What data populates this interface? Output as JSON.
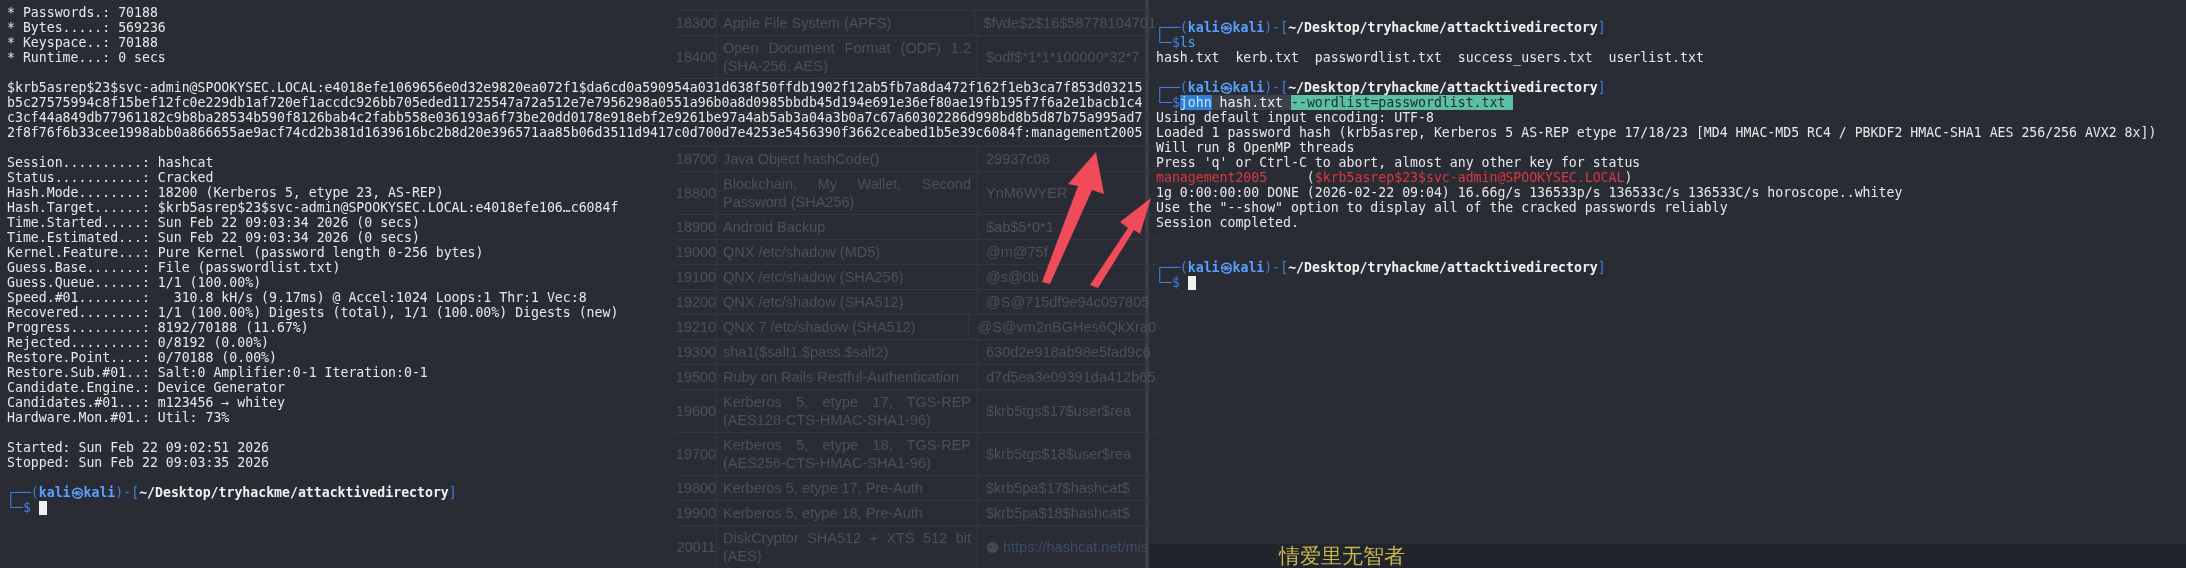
{
  "left_pane": {
    "lines": [
      {
        "kind": "text",
        "text": "* Passwords.: 70188"
      },
      {
        "kind": "text",
        "text": "* Bytes.....: 569236"
      },
      {
        "kind": "text",
        "text": "* Keyspace..: 70188"
      },
      {
        "kind": "text",
        "text": "* Runtime...: 0 secs"
      },
      {
        "kind": "blank"
      },
      {
        "kind": "wrapped",
        "text": "$krb5asrep$23$svc-admin@SPOOKYSEC.LOCAL:e4018efe1069656e0d32e9820ea072f1$da6cd0a590954a031d638f50ffdb1902f12ab5fb7a8da472f162f1eb3ca7f853d03215b5c27575994c8f15bef12fc0e229db1af720ef1accdc926bb705eded11725547a72a512e7e7956298a0551a96b0a8d0985bbdb45d194e691e36ef80ae19fb195f7f6a2e1bacb1c4c3cf44a849db77961182c9b8ba28534b590f8126bab4c2fabb558e036193a6f73be20dd0178e918ebf2e9261be97a4ab5ab3a04a3b0a7c67a60302286d998bd8b5d87b75a995ad72f8f76f6b33cee1998abb0a866655ae9acf74cd2b381d1639616bc2b8d20e396571aa85b06d3511d9417c0d700d7e4253e5456390f3662ceabed1b5e39c6084f:management2005"
      },
      {
        "kind": "blank"
      },
      {
        "kind": "text",
        "text": "Session..........: hashcat"
      },
      {
        "kind": "text",
        "text": "Status...........: Cracked"
      },
      {
        "kind": "text",
        "text": "Hash.Mode........: 18200 (Kerberos 5, etype 23, AS-REP)"
      },
      {
        "kind": "text",
        "text": "Hash.Target......: $krb5asrep$23$svc-admin@SPOOKYSEC.LOCAL:e4018efe106…c6084f"
      },
      {
        "kind": "text",
        "text": "Time.Started.....: Sun Feb 22 09:03:34 2026 (0 secs)"
      },
      {
        "kind": "text",
        "text": "Time.Estimated...: Sun Feb 22 09:03:34 2026 (0 secs)"
      },
      {
        "kind": "text",
        "text": "Kernel.Feature...: Pure Kernel (password length 0-256 bytes)"
      },
      {
        "kind": "text",
        "text": "Guess.Base.......: File (passwordlist.txt)"
      },
      {
        "kind": "text",
        "text": "Guess.Queue......: 1/1 (100.00%)"
      },
      {
        "kind": "text",
        "text": "Speed.#01........:   310.8 kH/s (9.17ms) @ Accel:1024 Loops:1 Thr:1 Vec:8"
      },
      {
        "kind": "text",
        "text": "Recovered........: 1/1 (100.00%) Digests (total), 1/1 (100.00%) Digests (new)"
      },
      {
        "kind": "text",
        "text": "Progress.........: 8192/70188 (11.67%)"
      },
      {
        "kind": "text",
        "text": "Rejected.........: 0/8192 (0.00%)"
      },
      {
        "kind": "text",
        "text": "Restore.Point....: 0/70188 (0.00%)"
      },
      {
        "kind": "text",
        "text": "Restore.Sub.#01..: Salt:0 Amplifier:0-1 Iteration:0-1"
      },
      {
        "kind": "text",
        "text": "Candidate.Engine.: Device Generator"
      },
      {
        "kind": "text",
        "text": "Candidates.#01...: m123456 → whitey"
      },
      {
        "kind": "text",
        "text": "Hardware.Mon.#01.: Util: 73%"
      },
      {
        "kind": "blank"
      },
      {
        "kind": "text",
        "text": "Started: Sun Feb 22 09:02:51 2026"
      },
      {
        "kind": "text",
        "text": "Stopped: Sun Feb 22 09:03:35 2026"
      },
      {
        "kind": "blank"
      },
      {
        "kind": "prompt",
        "head": [
          "┌──(",
          "kali㉿kali",
          ")-[",
          "~/Desktop/tryhackme/attacktivedirectory",
          "]"
        ],
        "tail": "└─$",
        "cursor": true
      }
    ]
  },
  "background_table": {
    "rows": [
      {
        "kind": "row",
        "mode": "18300",
        "name": "Apple File System (APFS)",
        "example": "$fvde$2$16$58778104701"
      },
      {
        "kind": "row",
        "mode": "18400",
        "name": "Open Document Format (ODF) 1.2 (SHA-256, AES)",
        "example": "$odf$*1*1*100000*32*7"
      },
      {
        "kind": "covered"
      },
      {
        "kind": "covered"
      },
      {
        "kind": "row",
        "mode": "18700",
        "name": "Java Object hashCode()",
        "example": "29937c08"
      },
      {
        "kind": "row",
        "mode": "18800",
        "name": "Blockchain, My Wallet, Second Password (SHA256)",
        "example": "YnM6WYER"
      },
      {
        "kind": "row",
        "mode": "18900",
        "name": "Android Backup",
        "example": "$ab$5*0*1"
      },
      {
        "kind": "row",
        "mode": "19000",
        "name": "QNX /etc/shadow (MD5)",
        "example": "@m@75f"
      },
      {
        "kind": "row",
        "mode": "19100",
        "name": "QNX /etc/shadow (SHA256)",
        "example": "@s@0b"
      },
      {
        "kind": "row",
        "mode": "19200",
        "name": "QNX /etc/shadow (SHA512)",
        "example": "@S@715df9e94c097805"
      },
      {
        "kind": "row",
        "mode": "19210",
        "name": "QNX 7 /etc/shadow (SHA512)",
        "example": "@S@vm2nBGHes6QkXra0"
      },
      {
        "kind": "row",
        "mode": "19300",
        "name": "sha1($salt1.$pass.$salt2)",
        "example": "630d2e918ab98e5fad9c6"
      },
      {
        "kind": "row",
        "mode": "19500",
        "name": "Ruby on Rails Restful-Authentication",
        "example": "d7d5ea3e09391da412b65"
      },
      {
        "kind": "row",
        "mode": "19600",
        "name": "Kerberos 5, etype 17, TGS-REP (AES128-CTS-HMAC-SHA1-96)",
        "example": "$krb5tgs$17$user$rea"
      },
      {
        "kind": "row",
        "mode": "19700",
        "name": "Kerberos 5, etype 18, TGS-REP (AES256-CTS-HMAC-SHA1-96)",
        "example": "$krb5tgs$18$user$rea"
      },
      {
        "kind": "row",
        "mode": "19800",
        "name": "Kerberos 5, etype 17, Pre-Auth",
        "example": "$krb5pa$17$hashcat$"
      },
      {
        "kind": "row",
        "mode": "19900",
        "name": "Kerberos 5, etype 18, Pre-Auth",
        "example": "$krb5pa$18$hashcat$"
      },
      {
        "kind": "link_row",
        "mode": "20011",
        "name": "DiskCryptor SHA512 + XTS 512 bit (AES)",
        "example": "https://hashcat.net/mis"
      }
    ]
  },
  "right_pane": {
    "lines": [
      {
        "kind": "blank"
      },
      {
        "kind": "prompt",
        "head": [
          "┌──(",
          "kali㉿kali",
          ")-[",
          "~/Desktop/tryhackme/attacktivedirectory",
          "]"
        ],
        "tail": "└─$",
        "command": [
          {
            "text": "ls",
            "kind": "program"
          }
        ],
        "cursor": false
      },
      {
        "kind": "text",
        "text": "hash.txt  kerb.txt  passwordlist.txt  success_users.txt  userlist.txt"
      },
      {
        "kind": "blank"
      },
      {
        "kind": "prompt",
        "head": [
          "┌──(",
          "kali㉿kali",
          ")-[",
          "~/Desktop/tryhackme/attacktivedirectory",
          "]"
        ],
        "tail": "└─$",
        "command": [
          {
            "text": "john",
            "kind": "selection"
          },
          {
            "text": " hash.txt ",
            "kind": "argument"
          },
          {
            "text": "--wordlist=passwordlist.txt ",
            "kind": "option"
          }
        ],
        "cursor": false
      },
      {
        "kind": "text",
        "text": "Using default input encoding: UTF-8"
      },
      {
        "kind": "text",
        "text": "Loaded 1 password hash (krb5asrep, Kerberos 5 AS-REP etype 17/18/23 [MD4 HMAC-MD5 RC4 / PBKDF2 HMAC-SHA1 AES 256/256 AVX2 8x])"
      },
      {
        "kind": "text",
        "text": "Will run 8 OpenMP threads"
      },
      {
        "kind": "text",
        "text": "Press 'q' or Ctrl-C to abort, almost any other key for status"
      },
      {
        "kind": "styled",
        "parts": [
          {
            "text": "management2005",
            "kind": "found"
          },
          {
            "text": "     (",
            "kind": "punctuation"
          },
          {
            "text": "$krb5asrep$23$svc-admin@SPOOKYSEC.LOCAL",
            "kind": "found"
          },
          {
            "text": ")",
            "kind": "punctuation"
          }
        ]
      },
      {
        "kind": "text",
        "text": "1g 0:00:00:00 DONE (2026-02-22 09:04) 16.66g/s 136533p/s 136533c/s 136533C/s horoscope..whitey"
      },
      {
        "kind": "text",
        "text": "Use the \"--show\" option to display all of the cracked passwords reliably"
      },
      {
        "kind": "text",
        "text": "Session completed."
      },
      {
        "kind": "blank"
      },
      {
        "kind": "blank"
      },
      {
        "kind": "prompt",
        "head": [
          "┌──(",
          "kali㉿kali",
          ")-[",
          "~/Desktop/tryhackme/attacktivedirectory",
          "]"
        ],
        "tail": "└─$",
        "cursor": true
      }
    ]
  },
  "lyrics_bar": {
    "text": "情爱里无智者"
  }
}
